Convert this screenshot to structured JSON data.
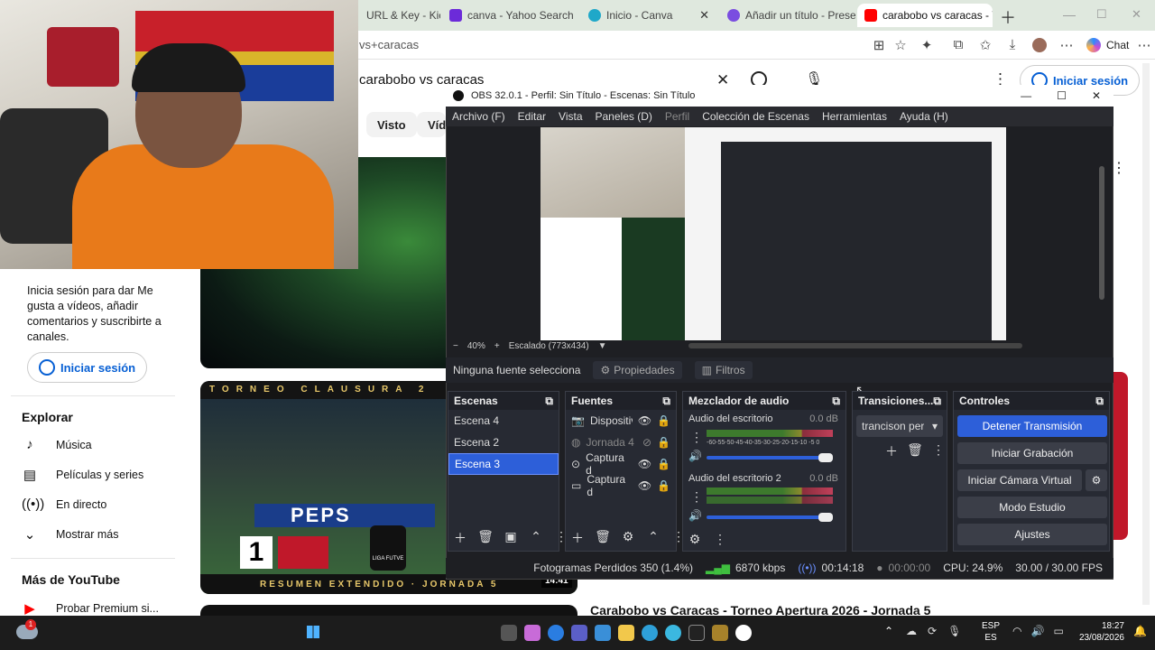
{
  "browser": {
    "tabs": [
      {
        "title": "URL & Key - Kic",
        "favicon_color": "#333333"
      },
      {
        "title": "canva - Yahoo Search",
        "favicon_color": "#6c2bd9"
      },
      {
        "title": "Inicio - Canva",
        "favicon_color": "#1fa8c9"
      },
      {
        "title": "Añadir un título - Prese",
        "favicon_color": "#7a4de0"
      },
      {
        "title": "carabobo vs caracas - Y",
        "favicon_color": "#ff0000"
      }
    ],
    "url": "vs+caracas",
    "chat_label": "Chat"
  },
  "youtube": {
    "search_value": "carabobo vs caracas",
    "signin_label": "Iniciar sesión",
    "chips": [
      "Visto",
      "Víde"
    ],
    "sidebar": {
      "signin_prompt": "Inicia sesión para dar Me gusta a vídeos, añadir comentarios y suscribirte a canales.",
      "signin_label": "Iniciar sesión",
      "explore_heading": "Explorar",
      "items": [
        {
          "label": "Música",
          "icon": "music-icon"
        },
        {
          "label": "Películas y series",
          "icon": "film-icon"
        },
        {
          "label": "En directo",
          "icon": "live-icon"
        },
        {
          "label": "Mostrar más",
          "icon": "chevron-down-icon"
        }
      ],
      "more_heading": "Más de YouTube",
      "premium_label": "Probar Premium si..."
    },
    "video": {
      "banner": "TORNEO CLAUSURA 2",
      "score": "1",
      "caption": "RESUMEN EXTENDIDO · JORNADA 5",
      "duration": "14:41",
      "logo": "LIGA FUTVE",
      "ad": "PEPS"
    },
    "next_title": "Carabobo vs Caracas - Torneo Apertura 2026 - Jornada 5"
  },
  "obs": {
    "title": "OBS 32.0.1 - Perfil: Sin Título - Escenas: Sin Título",
    "menu": [
      "Archivo (F)",
      "Editar",
      "Vista",
      "Paneles (D)",
      "Perfil",
      "Colección de Escenas",
      "Herramientas",
      "Ayuda (H)"
    ],
    "preview_bar": {
      "zoom": "40%",
      "scale": "Escalado (773x434)"
    },
    "source_bar": {
      "none_selected": "Ninguna fuente selecciona",
      "properties": "Propiedades",
      "filters": "Filtros"
    },
    "docks": {
      "scenes": {
        "title": "Escenas",
        "items": [
          "Escena 4",
          "Escena 2",
          "Escena 3"
        ],
        "selected": 2
      },
      "sources": {
        "title": "Fuentes",
        "items": [
          "Dispositiv",
          "Jornada 4",
          "Captura d",
          "Captura d"
        ]
      },
      "mixer": {
        "title": "Mezclador de audio",
        "channels": [
          {
            "name": "Audio del escritorio",
            "db": "0.0 dB"
          },
          {
            "name": "Audio del escritorio 2",
            "db": "0.0 dB"
          }
        ],
        "scale": "-60-55-50-45-40-35-30-25-20-15-10 -5  0"
      },
      "transitions": {
        "title": "Transiciones...",
        "selected": "trancison per"
      },
      "controls": {
        "title": "Controles",
        "buttons": [
          "Detener Transmisión",
          "Iniciar Grabación",
          "Iniciar Cámara Virtual",
          "Modo Estudio",
          "Ajustes"
        ]
      }
    },
    "status": {
      "frames_dropped": "Fotogramas Perdidos 350 (1.4%)",
      "bitrate": "6870 kbps",
      "stream_time": "00:14:18",
      "record_time": "00:00:00",
      "cpu": "CPU: 24.9%",
      "fps": "30.00 / 30.00 FPS"
    }
  },
  "taskbar": {
    "lang_top": "ESP",
    "lang_bottom": "ES",
    "time": "18:27",
    "date": "23/08/2026",
    "notification_count": "1"
  }
}
